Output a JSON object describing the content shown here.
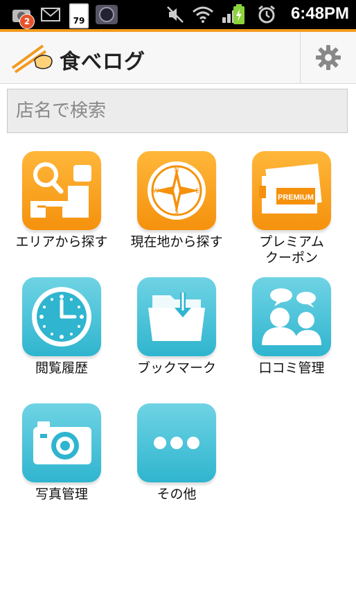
{
  "statusbar": {
    "notification_count": "2",
    "battery_small": "79",
    "time": "6:48PM"
  },
  "appbar": {
    "logo_text": "食べログ"
  },
  "search": {
    "placeholder": "店名で検索"
  },
  "tiles": [
    {
      "label": "エリアから探す"
    },
    {
      "label": "現在地から探す"
    },
    {
      "label": "プレミアム\nクーポン"
    },
    {
      "label": "閲覧履歴"
    },
    {
      "label": "ブックマーク"
    },
    {
      "label": "口コミ管理"
    },
    {
      "label": "写真管理"
    },
    {
      "label": "その他"
    }
  ],
  "icon_text": {
    "premium": "PREMIUM",
    "compass_n": "N",
    "compass_e": "E",
    "compass_s": "S",
    "compass_w": "W"
  },
  "colors": {
    "accent_orange": "#f39a1e",
    "tile_orange": "#f5910d",
    "tile_blue": "#2fb5cf"
  }
}
